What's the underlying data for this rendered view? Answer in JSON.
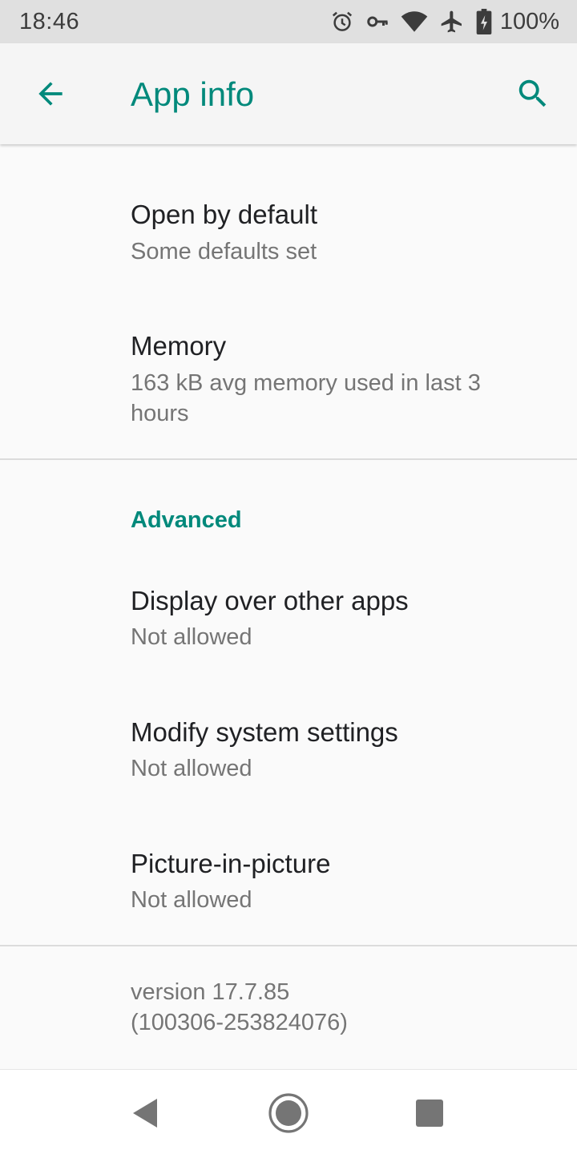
{
  "status_bar": {
    "time": "18:46",
    "battery": "100%",
    "icons": [
      "alarm-icon",
      "vpn-key-icon",
      "wifi-icon",
      "airplane-icon",
      "battery-charging-icon"
    ]
  },
  "app_bar": {
    "title": "App info",
    "back_icon": "arrow-back-icon",
    "search_icon": "search-icon"
  },
  "preferences": {
    "open_by_default": {
      "title": "Open by default",
      "summary": "Some defaults set"
    },
    "memory": {
      "title": "Memory",
      "summary": "163 kB avg memory used in last 3 hours"
    }
  },
  "advanced": {
    "header": "Advanced",
    "items": [
      {
        "title": "Display over other apps",
        "summary": "Not allowed"
      },
      {
        "title": "Modify system settings",
        "summary": "Not allowed"
      },
      {
        "title": "Picture-in-picture",
        "summary": "Not allowed"
      }
    ]
  },
  "footer": {
    "version": "version 17.7.85\n(100306-253824076)"
  },
  "nav_bar": {
    "icons": [
      "back-triangle-icon",
      "home-circle-icon",
      "recents-square-icon"
    ]
  },
  "colors": {
    "accent": "#00897b",
    "status_bar_bg": "#e0e0e0",
    "page_bg": "#fafafa"
  }
}
